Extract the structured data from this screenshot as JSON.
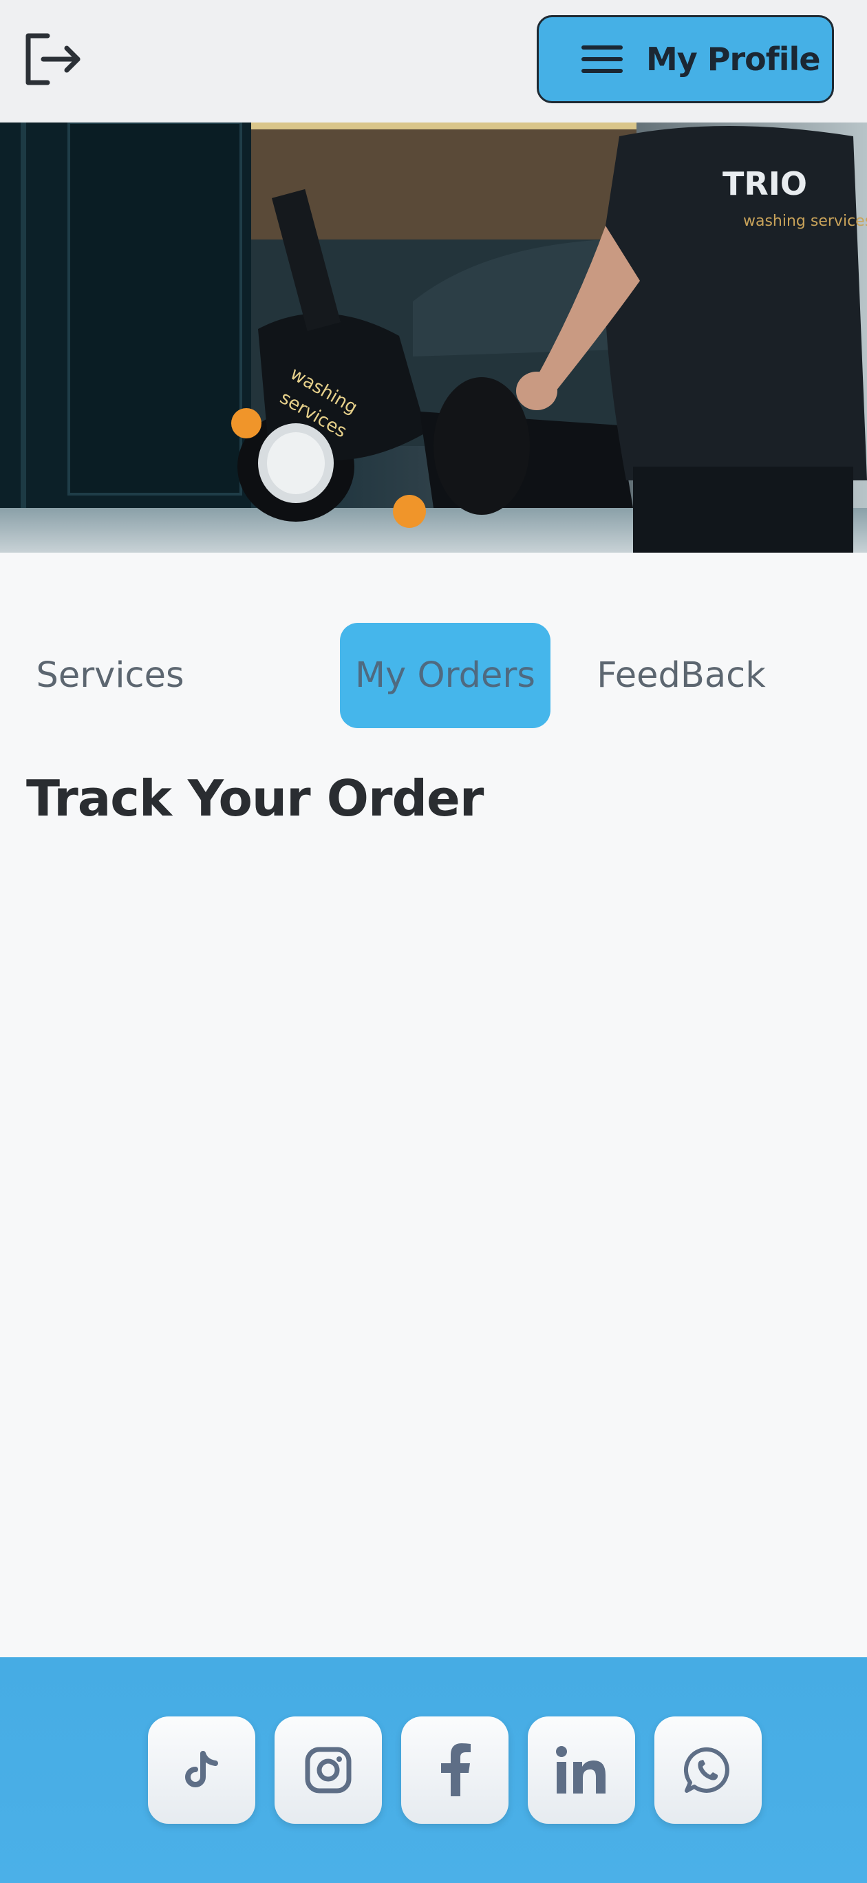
{
  "header": {
    "logout_icon": "logout-icon",
    "profile_button": {
      "label": "My Profile",
      "icon": "hamburger-menu-icon"
    }
  },
  "hero": {
    "image": "person-with-motorcycle-photo",
    "shirt_text": "TRIO",
    "shirt_subtext": "washing services",
    "windshield_text": "washing services"
  },
  "tabs": [
    {
      "label": "Services",
      "active": false
    },
    {
      "label": "My Orders",
      "active": true
    },
    {
      "label": "FeedBack",
      "active": false
    }
  ],
  "main": {
    "title": "Track Your Order"
  },
  "footer": {
    "social": [
      {
        "icon": "tiktok-icon"
      },
      {
        "icon": "instagram-icon"
      },
      {
        "icon": "facebook-icon"
      },
      {
        "icon": "linkedin-icon"
      },
      {
        "icon": "whatsapp-icon"
      }
    ]
  },
  "colors": {
    "accent": "#45b6eb",
    "text_dark": "#2a2d31",
    "icon": "#5e6e86"
  }
}
